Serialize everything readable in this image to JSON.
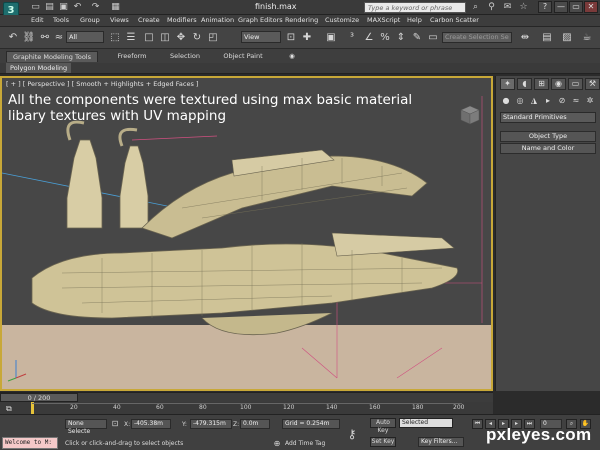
{
  "titlebar": {
    "app_logo": "3",
    "document_title": "finish.max",
    "search_placeholder": "Type a keyword or phrase",
    "window_buttons": [
      "▲",
      "☆",
      "?",
      "—",
      "▭",
      "✕"
    ]
  },
  "menubar": {
    "items": [
      "Edit",
      "Tools",
      "Group",
      "Views",
      "Create",
      "Modifiers",
      "Animation",
      "Graph Editors",
      "Rendering",
      "Customize",
      "MAXScript",
      "Help",
      "Carbon Scatter"
    ]
  },
  "toolbar": {
    "selection_filter": "All",
    "reference_coord": "View",
    "selection_set_placeholder": "Create Selection Se"
  },
  "ribbon": {
    "tabs": [
      "Graphite Modeling Tools",
      "Freeform",
      "Selection",
      "Object Paint"
    ],
    "panel_label": "Polygon Modeling"
  },
  "viewport": {
    "label": "[ + ] [ Perspective ] [ Smooth + Highlights + Edged Faces ]",
    "caption": "All the components were textured using max basic material libary textures with UV mapping",
    "border_color": "#c8a838",
    "floor_color": "#c9b59f",
    "model_color": "#d2c79a"
  },
  "command_panel": {
    "category_dropdown": "Standard Primitives",
    "rollouts": [
      "Object Type",
      "Name and Color"
    ]
  },
  "timeline": {
    "time_label": "0 / 200",
    "ticks": [
      "20",
      "40",
      "60",
      "80",
      "100",
      "120",
      "140",
      "160",
      "180",
      "200"
    ]
  },
  "status": {
    "listener_text": "Welcome to M:",
    "selection_info": "None Selecte",
    "x_label": "X:",
    "x_value": "-405.38m",
    "y_label": "Y:",
    "y_value": "-479.315m",
    "z_label": "Z:",
    "z_value": "0.0m",
    "grid": "Grid = 0.254m",
    "prompt": "Click or click-and-drag to select objects",
    "add_time_tag": "Add Time Tag",
    "auto_key": "Auto Key",
    "set_key": "Set Key",
    "key_filter_value": "Selected",
    "key_filters": "Key Filters...",
    "frame_value": "0"
  },
  "watermark": "pxleyes.com"
}
